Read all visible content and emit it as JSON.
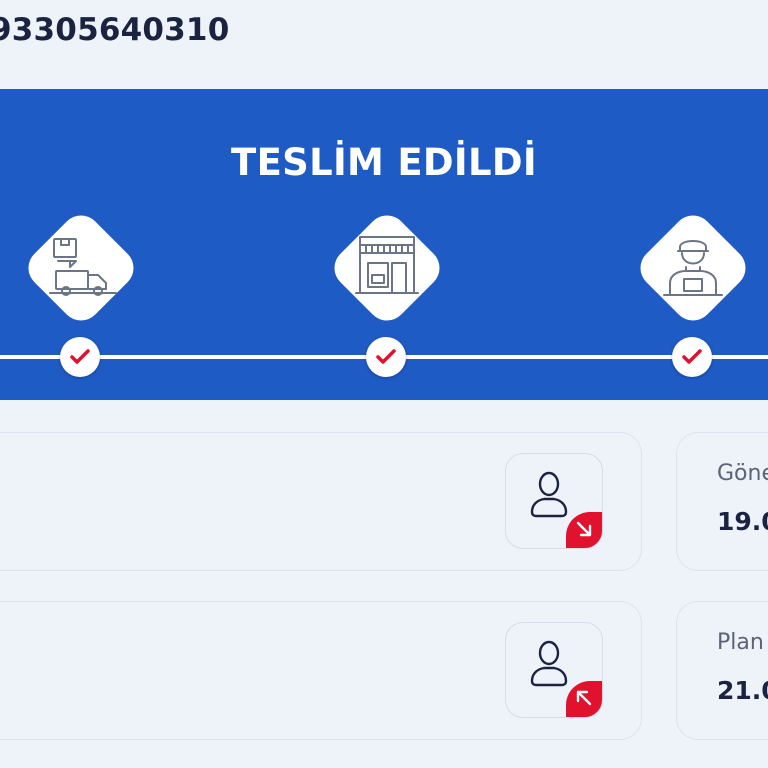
{
  "shipment": {
    "tracking_number": "93305640310"
  },
  "status": {
    "title": "TESLİM EDİLDİ",
    "steps": [
      {
        "icon": "delivery-truck-icon",
        "completed": true
      },
      {
        "icon": "store-icon",
        "completed": true
      },
      {
        "icon": "courier-icon",
        "completed": true
      }
    ]
  },
  "sender": {
    "icon": "sender-person-icon",
    "label": "Göne",
    "value": "19.0"
  },
  "planned": {
    "icon": "receiver-person-icon",
    "label": "Plan",
    "value": "21.0"
  },
  "colors": {
    "banner": "#1f5bc4",
    "accent_red": "#e0122e",
    "text_dark": "#1b2340",
    "background": "#eef2f9"
  }
}
